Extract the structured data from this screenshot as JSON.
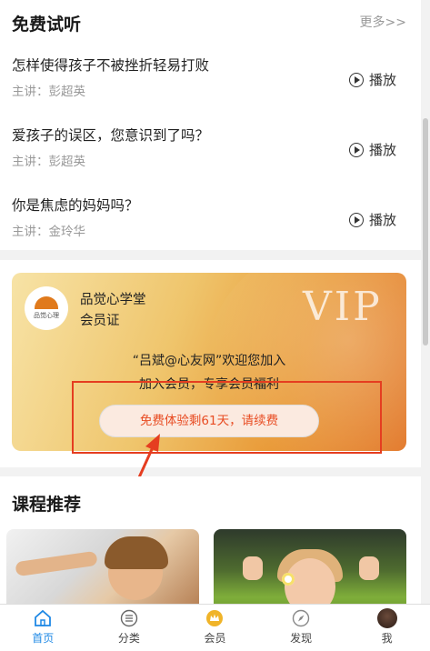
{
  "free": {
    "title": "免费试听",
    "more": "更多>>",
    "items": [
      {
        "title": "怎样使得孩子不被挫折轻易打败",
        "speaker": "主讲：彭超英",
        "play": "播放"
      },
      {
        "title": "爱孩子的误区，您意识到了吗？",
        "speaker": "主讲：彭超英",
        "play": "播放"
      },
      {
        "title": "你是焦虑的妈妈吗？",
        "speaker": "主讲：金玲华",
        "play": "播放"
      }
    ]
  },
  "vip": {
    "logo_text": "品觉心理",
    "org_name": "品觉心学堂",
    "cert": "会员证",
    "badge": "VIP",
    "welcome": "“吕斌@心友网”欢迎您加入",
    "join": "加入会员，专享会员福利",
    "button": "免费体验剩61天，请续费"
  },
  "recommend": {
    "title": "课程推荐"
  },
  "tabbar": {
    "items": [
      {
        "label": "首页",
        "icon": "home-icon",
        "active": true
      },
      {
        "label": "分类",
        "icon": "list-icon",
        "active": false
      },
      {
        "label": "会员",
        "icon": "crown-icon",
        "active": false
      },
      {
        "label": "发现",
        "icon": "compass-icon",
        "active": false
      },
      {
        "label": "我",
        "icon": "avatar",
        "active": false
      }
    ]
  },
  "colors": {
    "accent_blue": "#1e88e5",
    "highlight_red": "#e53d20",
    "vip_button_text": "#e84c22"
  }
}
